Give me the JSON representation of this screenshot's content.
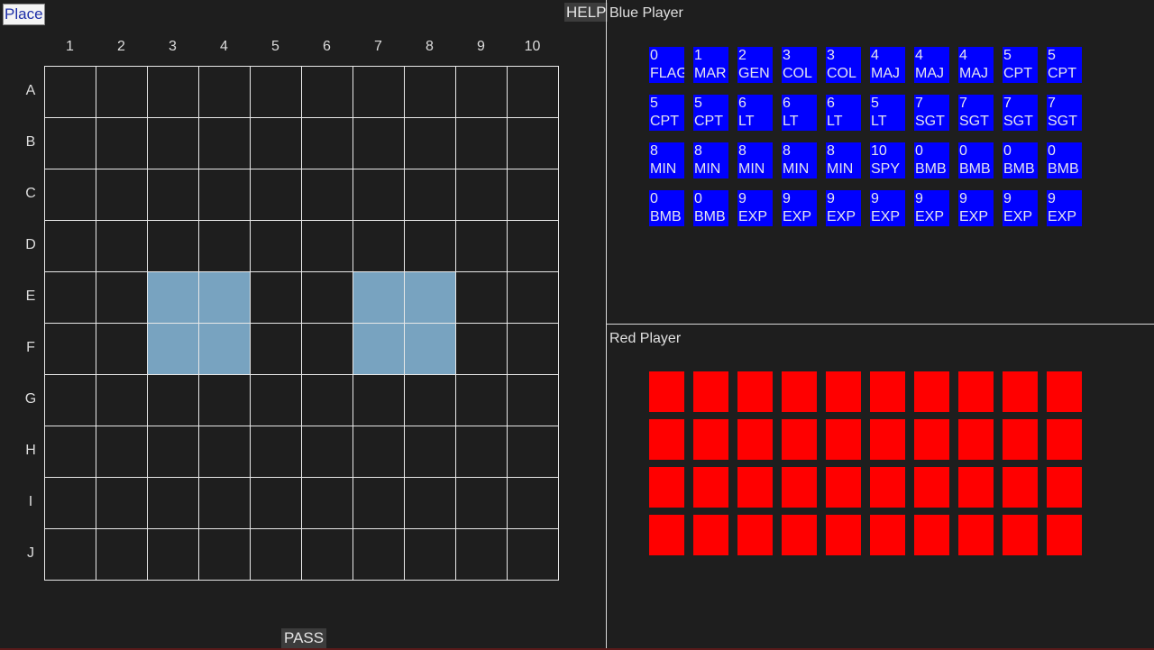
{
  "buttons": {
    "place": "Place",
    "help": "HELP",
    "pass": "PASS"
  },
  "board": {
    "columns": [
      "1",
      "2",
      "3",
      "4",
      "5",
      "6",
      "7",
      "8",
      "9",
      "10"
    ],
    "rows": [
      "A",
      "B",
      "C",
      "D",
      "E",
      "F",
      "G",
      "H",
      "I",
      "J"
    ],
    "lakes": [
      "E3",
      "E4",
      "F3",
      "F4",
      "E7",
      "E8",
      "F7",
      "F8"
    ]
  },
  "blue_player": {
    "title": "Blue Player",
    "pieces": [
      {
        "rank": "0",
        "name": "FLAG"
      },
      {
        "rank": "1",
        "name": "MAR"
      },
      {
        "rank": "2",
        "name": "GEN"
      },
      {
        "rank": "3",
        "name": "COL"
      },
      {
        "rank": "3",
        "name": "COL"
      },
      {
        "rank": "4",
        "name": "MAJ"
      },
      {
        "rank": "4",
        "name": "MAJ"
      },
      {
        "rank": "4",
        "name": "MAJ"
      },
      {
        "rank": "5",
        "name": "CPT"
      },
      {
        "rank": "5",
        "name": "CPT"
      },
      {
        "rank": "5",
        "name": "CPT"
      },
      {
        "rank": "5",
        "name": "CPT"
      },
      {
        "rank": "6",
        "name": "LT"
      },
      {
        "rank": "6",
        "name": "LT"
      },
      {
        "rank": "6",
        "name": "LT"
      },
      {
        "rank": "5",
        "name": "LT"
      },
      {
        "rank": "7",
        "name": "SGT"
      },
      {
        "rank": "7",
        "name": "SGT"
      },
      {
        "rank": "7",
        "name": "SGT"
      },
      {
        "rank": "7",
        "name": "SGT"
      },
      {
        "rank": "8",
        "name": "MIN"
      },
      {
        "rank": "8",
        "name": "MIN"
      },
      {
        "rank": "8",
        "name": "MIN"
      },
      {
        "rank": "8",
        "name": "MIN"
      },
      {
        "rank": "8",
        "name": "MIN"
      },
      {
        "rank": "10",
        "name": "SPY"
      },
      {
        "rank": "0",
        "name": "BMB"
      },
      {
        "rank": "0",
        "name": "BMB"
      },
      {
        "rank": "0",
        "name": "BMB"
      },
      {
        "rank": "0",
        "name": "BMB"
      },
      {
        "rank": "0",
        "name": "BMB"
      },
      {
        "rank": "0",
        "name": "BMB"
      },
      {
        "rank": "9",
        "name": "EXP"
      },
      {
        "rank": "9",
        "name": "EXP"
      },
      {
        "rank": "9",
        "name": "EXP"
      },
      {
        "rank": "9",
        "name": "EXP"
      },
      {
        "rank": "9",
        "name": "EXP"
      },
      {
        "rank": "9",
        "name": "EXP"
      },
      {
        "rank": "9",
        "name": "EXP"
      },
      {
        "rank": "9",
        "name": "EXP"
      }
    ]
  },
  "red_player": {
    "title": "Red Player",
    "hidden_piece_count": 40
  },
  "colors": {
    "blue_piece": "#0000ff",
    "red_piece": "#ff0000",
    "lake": "#78a3c0",
    "background": "#1e1e1e"
  }
}
